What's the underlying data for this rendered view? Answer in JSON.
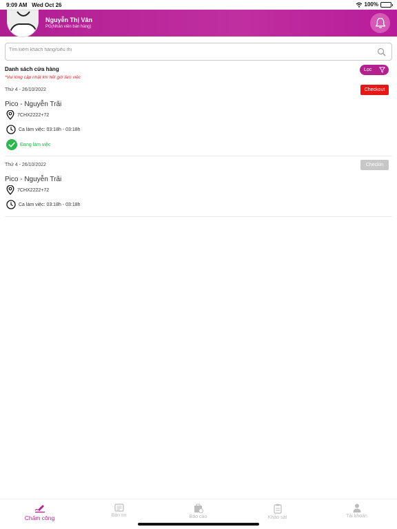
{
  "status_bar": {
    "time": "9:09 AM",
    "date": "Wed Oct 26",
    "battery": "100%"
  },
  "header": {
    "user_name": "Nguyễn Thị Vân",
    "user_role": "PG(Nhân viên bán hàng)",
    "accent_color": "#b5208f"
  },
  "search": {
    "placeholder": "Tìm kiếm khách hàng/siêu thị",
    "value": ""
  },
  "list": {
    "title": "Danh sách cửa hàng",
    "note": "*Vui lòng cập nhật khi hết giờ làm việc",
    "filter_label": "Lọc"
  },
  "stores": [
    {
      "date": "Thứ 4 - 26/10/2022",
      "action_label": "Checkout",
      "name": "Pico - Nguyễn Trãi",
      "location": "7CHX2222+72",
      "shift": "Ca làm việc: 03:18h - 03:18h",
      "status": "Đang làm việc"
    },
    {
      "date": "Thứ 4 - 26/10/2022",
      "action_label": "Checkin",
      "name": "Pico - Nguyễn Trãi",
      "location": "7CHX2222+72",
      "shift": "Ca làm việc: 03:18h - 03:18h"
    }
  ],
  "tabs": [
    {
      "label": "Chấm công",
      "icon": "pen-icon",
      "active": true
    },
    {
      "label": "Bản tin",
      "icon": "news-icon",
      "active": false
    },
    {
      "label": "Báo cáo",
      "icon": "report-icon",
      "active": false
    },
    {
      "label": "Khảo sát",
      "icon": "clipboard-icon",
      "active": false
    },
    {
      "label": "Tài khoản",
      "icon": "user-icon",
      "active": false
    }
  ]
}
